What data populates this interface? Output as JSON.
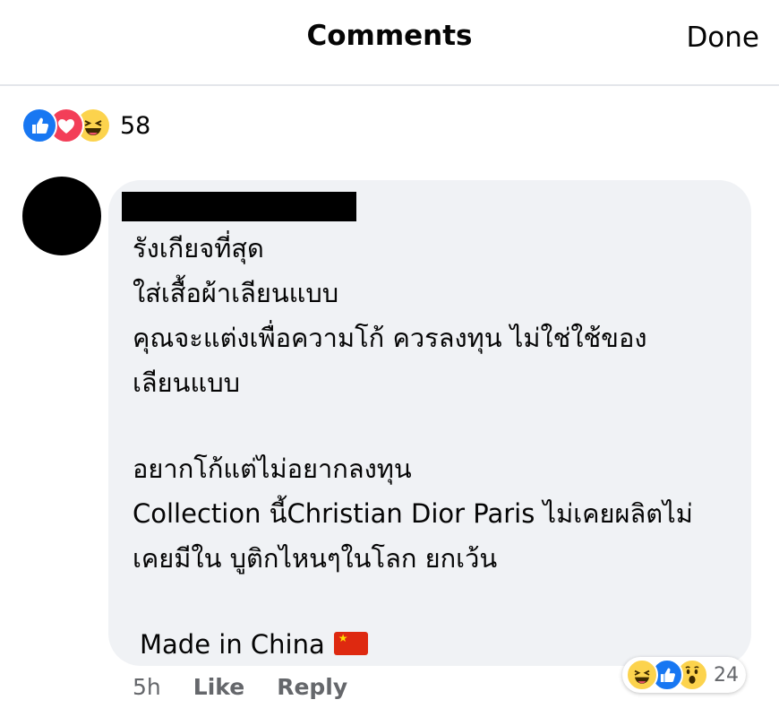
{
  "header": {
    "title": "Comments",
    "done_label": "Done"
  },
  "post_reactions": {
    "icons": [
      "like-icon",
      "love-icon",
      "haha-icon"
    ],
    "count": "58"
  },
  "comment": {
    "lines": [
      "รังเกียจที่สุด",
      "ใส่เสื้อผ้าเลียนแบบ",
      "คุณจะแต่งเพื่อความโก้ ควรลงทุน ไม่ใช่ใช้ของ",
      "เลียนแบบ",
      "อยากโก้แต่ไม่อยากลงทุน",
      "Collection นี้Christian Dior Paris ไม่เคยผลิตไม่",
      "เคยมีใน บูติกไหนๆในโลก ยกเว้น",
      "Made in China"
    ],
    "flag": "china-flag-icon",
    "time": "5h",
    "like_label": "Like",
    "reply_label": "Reply",
    "reaction_icons": [
      "haha-icon",
      "like-icon",
      "wow-icon"
    ],
    "reaction_count": "24"
  },
  "colors": {
    "like": "#1877f2",
    "love": "#f33e58",
    "haha": "#fcd34d",
    "bubble": "#f0f2f5",
    "secondary_text": "#65676b"
  }
}
